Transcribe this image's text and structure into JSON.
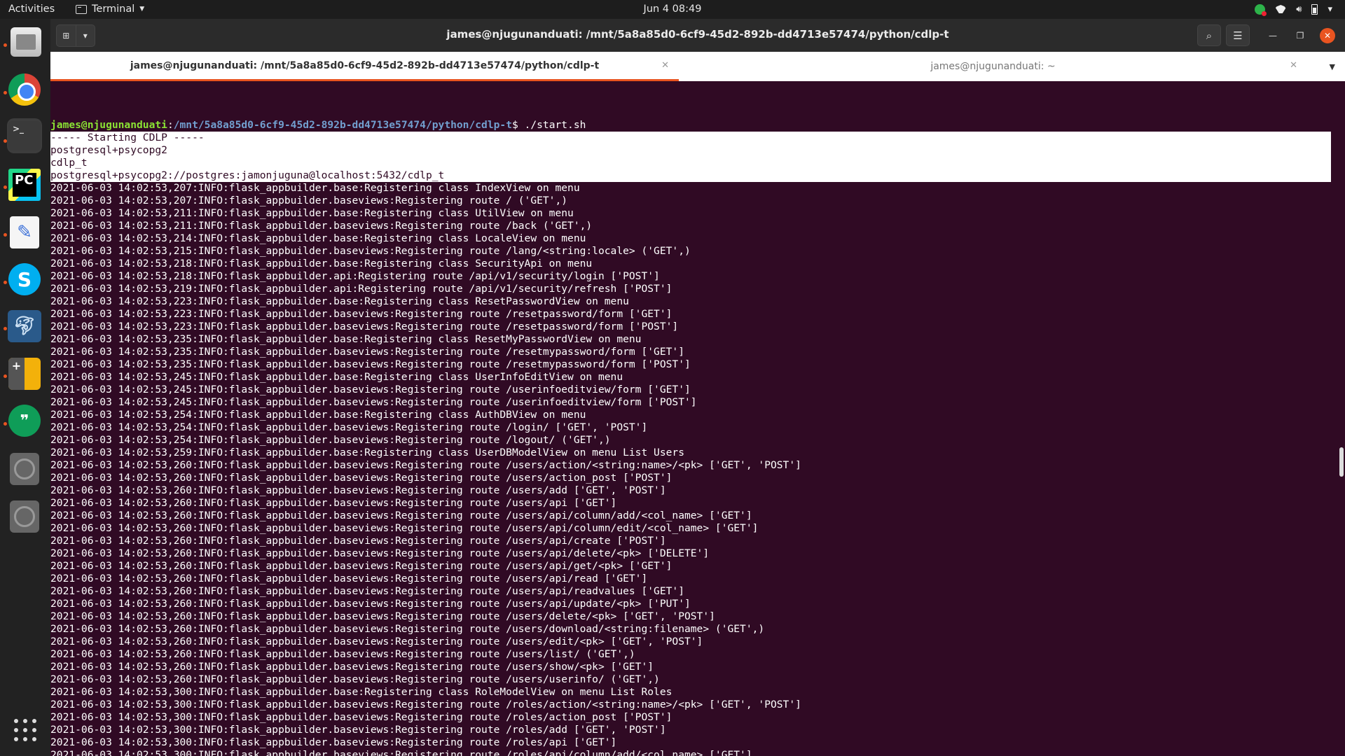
{
  "topbar": {
    "activities": "Activities",
    "app_name": "Terminal",
    "clock": "Jun 4  08:49"
  },
  "dock": {
    "apps": [
      "Files",
      "Google Chrome",
      "Terminal",
      "PyCharm",
      "Text Editor",
      "Skype",
      "MySQL Workbench",
      "Calculator",
      "Hangouts",
      "Disc",
      "Disc"
    ]
  },
  "window": {
    "title": "james@njugunanduati: /mnt/5a8a85d0-6cf9-45d2-892b-dd4713e57474/python/cdlp-t"
  },
  "tabs": [
    {
      "label": "james@njugunanduati: /mnt/5a8a85d0-6cf9-45d2-892b-dd4713e57474/python/cdlp-t",
      "active": true
    },
    {
      "label": "james@njugunanduati: ~",
      "active": false
    }
  ],
  "terminal": {
    "prompt_user": "james@njugunanduati",
    "prompt_path": "/mnt/5a8a85d0-6cf9-45d2-892b-dd4713e57474/python/cdlp-t",
    "command": "$ ./start.sh",
    "selected_lines": [
      "----- Starting CDLP -----",
      "postgresql+psycopg2",
      "cdlp_t",
      "postgresql+psycopg2://postgres:jamonjuguna@localhost:5432/cdlp_t"
    ],
    "lines": [
      "2021-06-03 14:02:53,207:INFO:flask_appbuilder.base:Registering class IndexView on menu",
      "2021-06-03 14:02:53,207:INFO:flask_appbuilder.baseviews:Registering route / ('GET',)",
      "2021-06-03 14:02:53,211:INFO:flask_appbuilder.base:Registering class UtilView on menu",
      "2021-06-03 14:02:53,211:INFO:flask_appbuilder.baseviews:Registering route /back ('GET',)",
      "2021-06-03 14:02:53,214:INFO:flask_appbuilder.base:Registering class LocaleView on menu",
      "2021-06-03 14:02:53,215:INFO:flask_appbuilder.baseviews:Registering route /lang/<string:locale> ('GET',)",
      "2021-06-03 14:02:53,218:INFO:flask_appbuilder.base:Registering class SecurityApi on menu",
      "2021-06-03 14:02:53,218:INFO:flask_appbuilder.api:Registering route /api/v1/security/login ['POST']",
      "2021-06-03 14:02:53,219:INFO:flask_appbuilder.api:Registering route /api/v1/security/refresh ['POST']",
      "2021-06-03 14:02:53,223:INFO:flask_appbuilder.base:Registering class ResetPasswordView on menu",
      "2021-06-03 14:02:53,223:INFO:flask_appbuilder.baseviews:Registering route /resetpassword/form ['GET']",
      "2021-06-03 14:02:53,223:INFO:flask_appbuilder.baseviews:Registering route /resetpassword/form ['POST']",
      "2021-06-03 14:02:53,235:INFO:flask_appbuilder.base:Registering class ResetMyPasswordView on menu",
      "2021-06-03 14:02:53,235:INFO:flask_appbuilder.baseviews:Registering route /resetmypassword/form ['GET']",
      "2021-06-03 14:02:53,235:INFO:flask_appbuilder.baseviews:Registering route /resetmypassword/form ['POST']",
      "2021-06-03 14:02:53,245:INFO:flask_appbuilder.base:Registering class UserInfoEditView on menu",
      "2021-06-03 14:02:53,245:INFO:flask_appbuilder.baseviews:Registering route /userinfoeditview/form ['GET']",
      "2021-06-03 14:02:53,245:INFO:flask_appbuilder.baseviews:Registering route /userinfoeditview/form ['POST']",
      "2021-06-03 14:02:53,254:INFO:flask_appbuilder.base:Registering class AuthDBView on menu",
      "2021-06-03 14:02:53,254:INFO:flask_appbuilder.baseviews:Registering route /login/ ['GET', 'POST']",
      "2021-06-03 14:02:53,254:INFO:flask_appbuilder.baseviews:Registering route /logout/ ('GET',)",
      "2021-06-03 14:02:53,259:INFO:flask_appbuilder.base:Registering class UserDBModelView on menu List Users",
      "2021-06-03 14:02:53,260:INFO:flask_appbuilder.baseviews:Registering route /users/action/<string:name>/<pk> ['GET', 'POST']",
      "2021-06-03 14:02:53,260:INFO:flask_appbuilder.baseviews:Registering route /users/action_post ['POST']",
      "2021-06-03 14:02:53,260:INFO:flask_appbuilder.baseviews:Registering route /users/add ['GET', 'POST']",
      "2021-06-03 14:02:53,260:INFO:flask_appbuilder.baseviews:Registering route /users/api ['GET']",
      "2021-06-03 14:02:53,260:INFO:flask_appbuilder.baseviews:Registering route /users/api/column/add/<col_name> ['GET']",
      "2021-06-03 14:02:53,260:INFO:flask_appbuilder.baseviews:Registering route /users/api/column/edit/<col_name> ['GET']",
      "2021-06-03 14:02:53,260:INFO:flask_appbuilder.baseviews:Registering route /users/api/create ['POST']",
      "2021-06-03 14:02:53,260:INFO:flask_appbuilder.baseviews:Registering route /users/api/delete/<pk> ['DELETE']",
      "2021-06-03 14:02:53,260:INFO:flask_appbuilder.baseviews:Registering route /users/api/get/<pk> ['GET']",
      "2021-06-03 14:02:53,260:INFO:flask_appbuilder.baseviews:Registering route /users/api/read ['GET']",
      "2021-06-03 14:02:53,260:INFO:flask_appbuilder.baseviews:Registering route /users/api/readvalues ['GET']",
      "2021-06-03 14:02:53,260:INFO:flask_appbuilder.baseviews:Registering route /users/api/update/<pk> ['PUT']",
      "2021-06-03 14:02:53,260:INFO:flask_appbuilder.baseviews:Registering route /users/delete/<pk> ['GET', 'POST']",
      "2021-06-03 14:02:53,260:INFO:flask_appbuilder.baseviews:Registering route /users/download/<string:filename> ('GET',)",
      "2021-06-03 14:02:53,260:INFO:flask_appbuilder.baseviews:Registering route /users/edit/<pk> ['GET', 'POST']",
      "2021-06-03 14:02:53,260:INFO:flask_appbuilder.baseviews:Registering route /users/list/ ('GET',)",
      "2021-06-03 14:02:53,260:INFO:flask_appbuilder.baseviews:Registering route /users/show/<pk> ['GET']",
      "2021-06-03 14:02:53,260:INFO:flask_appbuilder.baseviews:Registering route /users/userinfo/ ('GET',)",
      "2021-06-03 14:02:53,300:INFO:flask_appbuilder.base:Registering class RoleModelView on menu List Roles",
      "2021-06-03 14:02:53,300:INFO:flask_appbuilder.baseviews:Registering route /roles/action/<string:name>/<pk> ['GET', 'POST']",
      "2021-06-03 14:02:53,300:INFO:flask_appbuilder.baseviews:Registering route /roles/action_post ['POST']",
      "2021-06-03 14:02:53,300:INFO:flask_appbuilder.baseviews:Registering route /roles/add ['GET', 'POST']",
      "2021-06-03 14:02:53,300:INFO:flask_appbuilder.baseviews:Registering route /roles/api ['GET']",
      "2021-06-03 14:02:53,300:INFO:flask_appbuilder.baseviews:Registering route /roles/api/column/add/<col_name> ['GET']"
    ]
  }
}
